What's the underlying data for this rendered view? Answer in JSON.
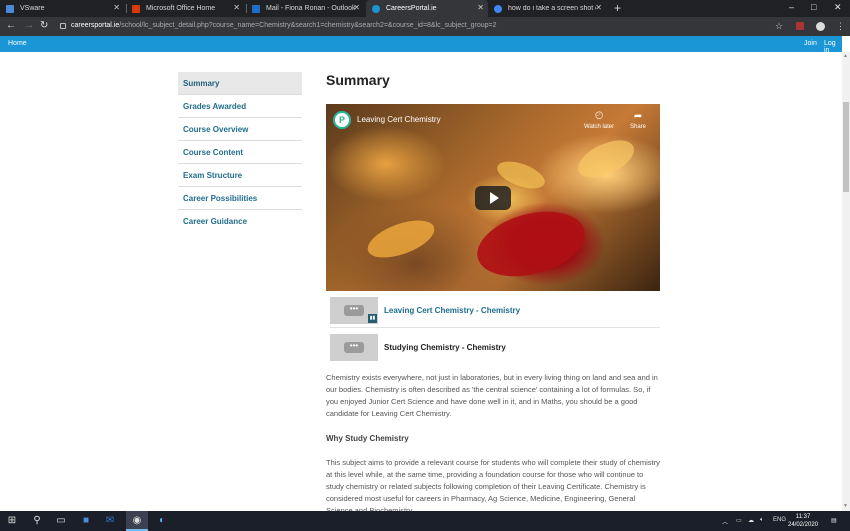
{
  "browser": {
    "tabs": [
      {
        "label": "VSware",
        "color": "#4b8bd6"
      },
      {
        "label": "Microsoft Office Home",
        "color": "#d83b01"
      },
      {
        "label": "Mail - Fiona Ronan - Outlook",
        "color": "#1f6fc5"
      },
      {
        "label": "CareersPortal.ie",
        "color": "#1a96d6"
      },
      {
        "label": "how do i take a screen shot on a",
        "color": "#4285f4"
      }
    ],
    "new_tab": "+",
    "window_controls": {
      "minimize": "–",
      "maximize": "□",
      "close": "✕"
    },
    "url": {
      "host": "careersportal.ie",
      "path": "/school/lc_subject_detail.php?course_name=Chemistry&search1=chemistry&search2=&course_id=8&lc_subject_group=2"
    }
  },
  "site": {
    "nav": {
      "home": "Home",
      "join": "Join",
      "login": "Log in"
    },
    "accent": "#1a96d6",
    "side_menu": [
      "Summary",
      "Grades Awarded",
      "Course Overview",
      "Course Content",
      "Exam Structure",
      "Career Possibilities",
      "Career Guidance"
    ],
    "summary_title": "Summary",
    "video": {
      "logo": "P",
      "title": "Leaving Cert Chemistry",
      "watch_later": "Watch later",
      "share": "Share"
    },
    "related": [
      {
        "title": "Leaving Cert Chemistry - Chemistry",
        "thumb": "•••",
        "badge": "▮▮"
      },
      {
        "title": "Studying Chemistry - Chemistry",
        "thumb": "•••"
      }
    ],
    "intro": "Chemistry exists everywhere, not just in laboratories, but in every living thing on land and sea and in our bodies. Chemistry is often described as 'the central science' containing a lot of formulas. So, if you enjoyed Junior Cert Science and have done well in it, and in Maths, you should be a good candidate for Leaving Cert Chemistry.",
    "why_heading": "Why Study Chemistry",
    "why_text": "This subject aims to provide a relevant course for students who will complete their study of chemistry at this level while, at the same time, providing a foundation course for those who will continue to study chemistry or related subjects following completion of their Leaving Certificate. Chemistry is considered most useful for careers in Pharmacy, Ag Science, Medicine, Engineering, General Science and Biochemistry."
  },
  "taskbar": {
    "tray": {
      "lang": "ENG"
    },
    "time": "11:37",
    "date": "24/02/2020"
  }
}
